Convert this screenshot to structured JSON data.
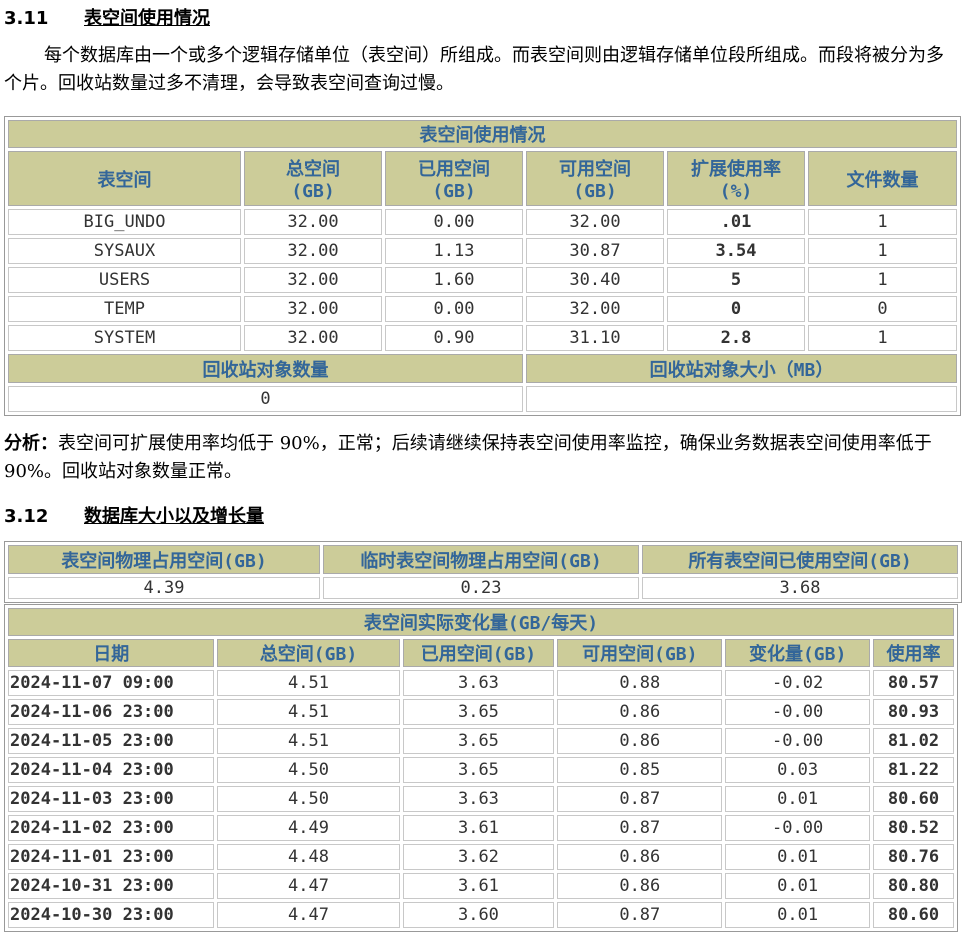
{
  "s311": {
    "num": "3.11",
    "title": "表空间使用情况",
    "intro": "每个数据库由一个或多个逻辑存储单位（表空间）所组成。而表空间则由逻辑存储单位段所组成。而段将被分为多个片。回收站数量过多不清理，会导致表空间查询过慢。",
    "table": {
      "caption": "表空间使用情况",
      "headers": [
        "表空间",
        "总空间",
        "(GB)",
        "已用空间",
        "(GB)",
        "可用空间",
        "(GB)",
        "扩展使用率",
        "(%)",
        "文件数量"
      ],
      "rows": [
        [
          "BIG_UNDO",
          "32.00",
          "0.00",
          "32.00",
          ".01",
          "1"
        ],
        [
          "SYSAUX",
          "32.00",
          "1.13",
          "30.87",
          "3.54",
          "1"
        ],
        [
          "USERS",
          "32.00",
          "1.60",
          "30.40",
          "5",
          "1"
        ],
        [
          "TEMP",
          "32.00",
          "0.00",
          "32.00",
          "0",
          "0"
        ],
        [
          "SYSTEM",
          "32.00",
          "0.90",
          "31.10",
          "2.8",
          "1"
        ]
      ],
      "recycle_count_label": "回收站对象数量",
      "recycle_size_label": "回收站对象大小（MB）",
      "recycle_count": "0",
      "recycle_size": ""
    },
    "analysis_label": "分析：",
    "analysis": "表空间可扩展使用率均低于 90%，正常；后续请继续保持表空间使用率监控，确保业务数据表空间使用率低于 90%。回收站对象数量正常。"
  },
  "s312": {
    "num": "3.12",
    "title": "数据库大小以及增长量",
    "summary_headers": [
      "表空间物理占用空间(GB)",
      "临时表空间物理占用空间(GB)",
      "所有表空间已使用空间(GB)"
    ],
    "summary_values": [
      "4.39",
      "0.23",
      "3.68"
    ],
    "change_caption": "表空间实际变化量(GB/每天)",
    "change_headers": [
      "日期",
      "总空间(GB)",
      "已用空间(GB)",
      "可用空间(GB)",
      "变化量(GB)",
      "使用率"
    ],
    "rows": [
      [
        "2024-11-07 09:00",
        "4.51",
        "3.63",
        "0.88",
        "-0.02",
        "80.57"
      ],
      [
        "2024-11-06 23:00",
        "4.51",
        "3.65",
        "0.86",
        "-0.00",
        "80.93"
      ],
      [
        "2024-11-05 23:00",
        "4.51",
        "3.65",
        "0.86",
        "-0.00",
        "81.02"
      ],
      [
        "2024-11-04 23:00",
        "4.50",
        "3.65",
        "0.85",
        "0.03",
        "81.22"
      ],
      [
        "2024-11-03 23:00",
        "4.50",
        "3.63",
        "0.87",
        "0.01",
        "80.60"
      ],
      [
        "2024-11-02 23:00",
        "4.49",
        "3.61",
        "0.87",
        "-0.00",
        "80.52"
      ],
      [
        "2024-11-01 23:00",
        "4.48",
        "3.62",
        "0.86",
        "0.01",
        "80.76"
      ],
      [
        "2024-10-31 23:00",
        "4.47",
        "3.61",
        "0.86",
        "0.01",
        "80.80"
      ],
      [
        "2024-10-30 23:00",
        "4.47",
        "3.60",
        "0.87",
        "0.01",
        "80.60"
      ]
    ]
  },
  "colors": {
    "header_bg": "#cccc99",
    "header_text": "#336699",
    "value_green": "#336633"
  }
}
